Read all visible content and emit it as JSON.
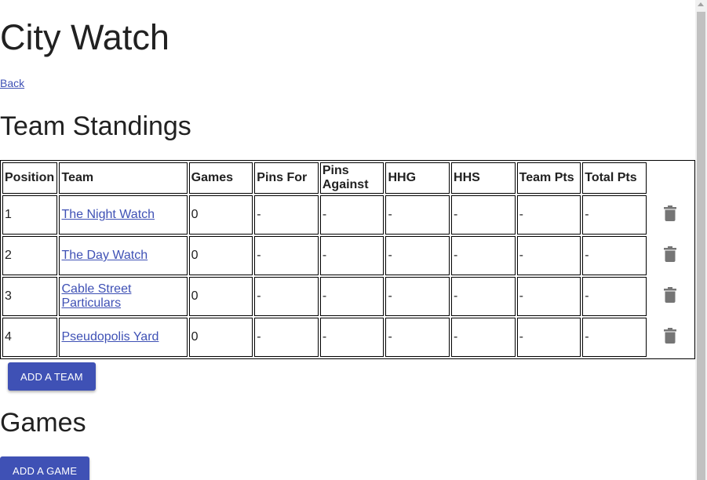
{
  "page": {
    "title": "City Watch",
    "back_label": "Back"
  },
  "standings": {
    "heading": "Team Standings",
    "columns": [
      "Position",
      "Team",
      "Games",
      "Pins For",
      "Pins Against",
      "HHG",
      "HHS",
      "Team Pts",
      "Total Pts"
    ],
    "rows": [
      {
        "position": "1",
        "team": "The Night Watch",
        "games": "0",
        "pins_for": "-",
        "pins_against": "-",
        "hhg": "-",
        "hhs": "-",
        "team_pts": "-",
        "total_pts": "-"
      },
      {
        "position": "2",
        "team": "The Day Watch",
        "games": "0",
        "pins_for": "-",
        "pins_against": "-",
        "hhg": "-",
        "hhs": "-",
        "team_pts": "-",
        "total_pts": "-"
      },
      {
        "position": "3",
        "team": "Cable Street Particulars",
        "games": "0",
        "pins_for": "-",
        "pins_against": "-",
        "hhg": "-",
        "hhs": "-",
        "team_pts": "-",
        "total_pts": "-"
      },
      {
        "position": "4",
        "team": "Pseudopolis Yard",
        "games": "0",
        "pins_for": "-",
        "pins_against": "-",
        "hhg": "-",
        "hhs": "-",
        "team_pts": "-",
        "total_pts": "-"
      }
    ],
    "add_team_label": "ADD A TEAM",
    "delete_icon": "trash-icon"
  },
  "games": {
    "heading": "Games",
    "add_game_label": "ADD A GAME"
  },
  "colors": {
    "primary": "#3f51b5",
    "text": "#212121",
    "icon": "#757575"
  }
}
